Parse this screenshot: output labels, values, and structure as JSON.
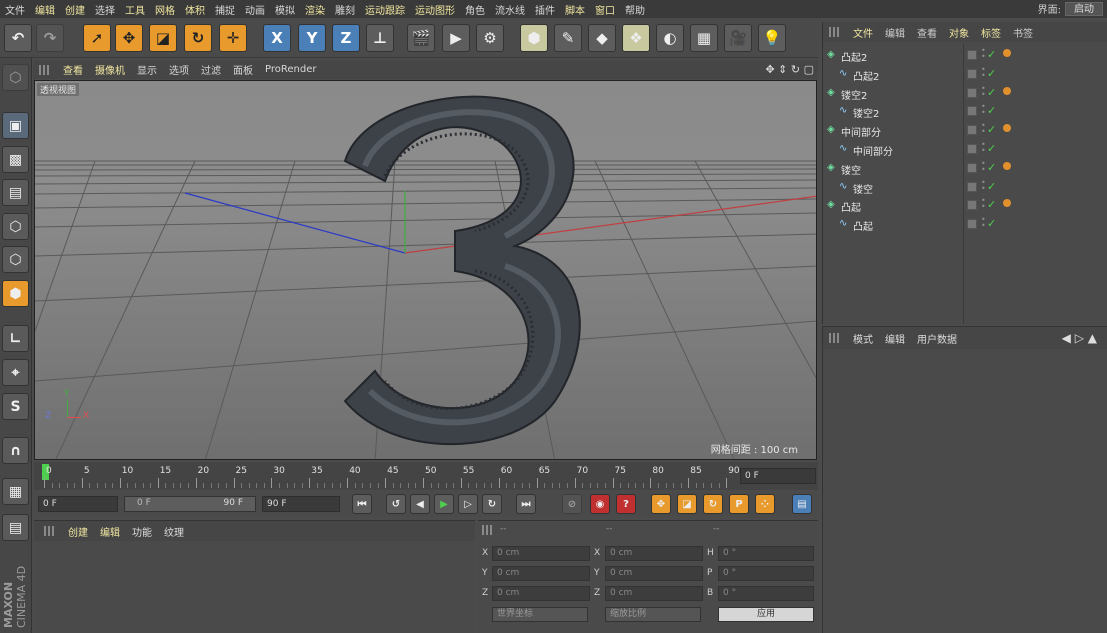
{
  "menubar": {
    "items": [
      "文件",
      "编辑",
      "创建",
      "选择",
      "工具",
      "网格",
      "体积",
      "捕捉",
      "动画",
      "模拟",
      "渲染",
      "雕刻",
      "运动跟踪",
      "运动图形",
      "角色",
      "流水线",
      "插件",
      "脚本",
      "窗口",
      "帮助"
    ],
    "interface_label": "界面:",
    "interface_value": "启动"
  },
  "toolbar": {
    "axis_x": "X",
    "axis_y": "Y",
    "axis_z": "Z"
  },
  "viewport": {
    "menu": [
      "查看",
      "摄像机",
      "显示",
      "选项",
      "过滤",
      "面板",
      "ProRender"
    ],
    "label": "透视视图",
    "grid_spacing": "网格间距 : 100 cm",
    "axis_y": "Y",
    "axis_z": "Z",
    "axis_x": "X"
  },
  "timeline": {
    "ticks": [
      "0",
      "5",
      "10",
      "15",
      "20",
      "25",
      "30",
      "35",
      "40",
      "45",
      "50",
      "55",
      "60",
      "65",
      "70",
      "75",
      "80",
      "85",
      "90"
    ],
    "current_frame": "0 F"
  },
  "transport": {
    "start": "0 F",
    "range_start": "0 F",
    "range_end": "90 F",
    "end": "90 F"
  },
  "material": {
    "menu": [
      "创建",
      "编辑",
      "功能",
      "纹理"
    ]
  },
  "coords": {
    "headers": [
      "--",
      "--",
      "--"
    ],
    "rows": [
      {
        "a": "X",
        "av": "0 cm",
        "b": "X",
        "bv": "0 cm",
        "c": "H",
        "cv": "0 °"
      },
      {
        "a": "Y",
        "av": "0 cm",
        "b": "Y",
        "bv": "0 cm",
        "c": "P",
        "cv": "0 °"
      },
      {
        "a": "Z",
        "av": "0 cm",
        "b": "Z",
        "bv": "0 cm",
        "c": "B",
        "cv": "0 °"
      }
    ],
    "world": "世界坐标",
    "scale": "缩放比例",
    "apply": "应用"
  },
  "objects": {
    "menu": [
      "文件",
      "编辑",
      "查看",
      "对象",
      "标签",
      "书签"
    ],
    "items": [
      {
        "name": "凸起2",
        "level": 0
      },
      {
        "name": "凸起2",
        "level": 1
      },
      {
        "name": "镂空2",
        "level": 0
      },
      {
        "name": "镂空2",
        "level": 1
      },
      {
        "name": "中间部分",
        "level": 0
      },
      {
        "name": "中间部分",
        "level": 1
      },
      {
        "name": "镂空",
        "level": 0
      },
      {
        "name": "镂空",
        "level": 1
      },
      {
        "name": "凸起",
        "level": 0
      },
      {
        "name": "凸起",
        "level": 1
      }
    ]
  },
  "attributes": {
    "menu": [
      "模式",
      "编辑",
      "用户数据"
    ]
  },
  "brand": {
    "maxon": "MAXON",
    "product": "CINEMA 4D"
  },
  "colors": {
    "accent": "#e89a2c",
    "highlight": "#f0e6a0",
    "viewport": "#8a8a8a",
    "axis_red": "#c04040",
    "axis_green": "#3fae3f",
    "axis_blue": "#2a3ac8"
  }
}
